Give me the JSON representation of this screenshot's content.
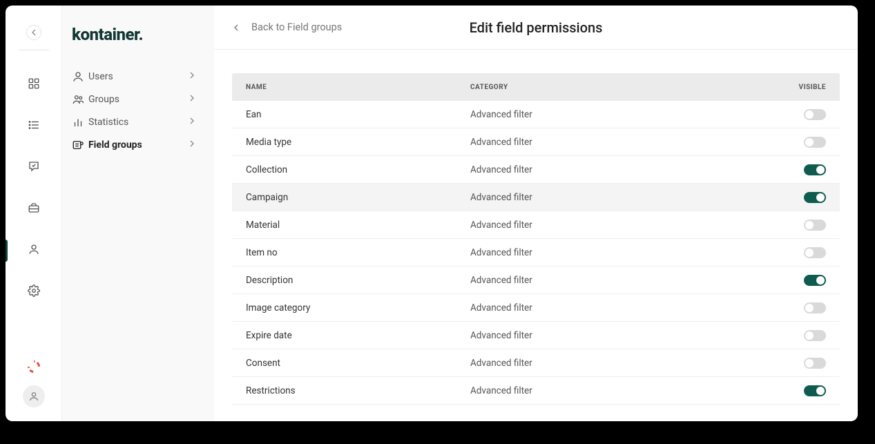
{
  "brand": {
    "logo_text": "kontainer."
  },
  "header": {
    "back_label": "Back to Field groups",
    "title": "Edit field permissions"
  },
  "sidebar": {
    "items": [
      {
        "icon": "user",
        "label": "Users",
        "active": false
      },
      {
        "icon": "group",
        "label": "Groups",
        "active": false
      },
      {
        "icon": "stats",
        "label": "Statistics",
        "active": false
      },
      {
        "icon": "fieldgroup",
        "label": "Field groups",
        "active": true
      }
    ]
  },
  "rail": {
    "items": [
      {
        "icon": "apps",
        "active": false
      },
      {
        "icon": "list",
        "active": false
      },
      {
        "icon": "chat",
        "active": false
      },
      {
        "icon": "briefcase",
        "active": false
      },
      {
        "icon": "user",
        "active": true
      },
      {
        "icon": "gear",
        "active": false
      }
    ]
  },
  "table": {
    "columns": {
      "name": "NAME",
      "category": "CATEGORY",
      "visible": "VISIBLE"
    },
    "rows": [
      {
        "name": "Ean",
        "category": "Advanced filter",
        "visible": false,
        "hovered": false
      },
      {
        "name": "Media type",
        "category": "Advanced filter",
        "visible": false,
        "hovered": false
      },
      {
        "name": "Collection",
        "category": "Advanced filter",
        "visible": true,
        "hovered": false
      },
      {
        "name": "Campaign",
        "category": "Advanced filter",
        "visible": true,
        "hovered": true
      },
      {
        "name": "Material",
        "category": "Advanced filter",
        "visible": false,
        "hovered": false
      },
      {
        "name": "Item no",
        "category": "Advanced filter",
        "visible": false,
        "hovered": false
      },
      {
        "name": "Description",
        "category": "Advanced filter",
        "visible": true,
        "hovered": false
      },
      {
        "name": "Image category",
        "category": "Advanced filter",
        "visible": false,
        "hovered": false
      },
      {
        "name": "Expire date",
        "category": "Advanced filter",
        "visible": false,
        "hovered": false
      },
      {
        "name": "Consent",
        "category": "Advanced filter",
        "visible": false,
        "hovered": false
      },
      {
        "name": "Restrictions",
        "category": "Advanced filter",
        "visible": true,
        "hovered": false
      }
    ]
  }
}
